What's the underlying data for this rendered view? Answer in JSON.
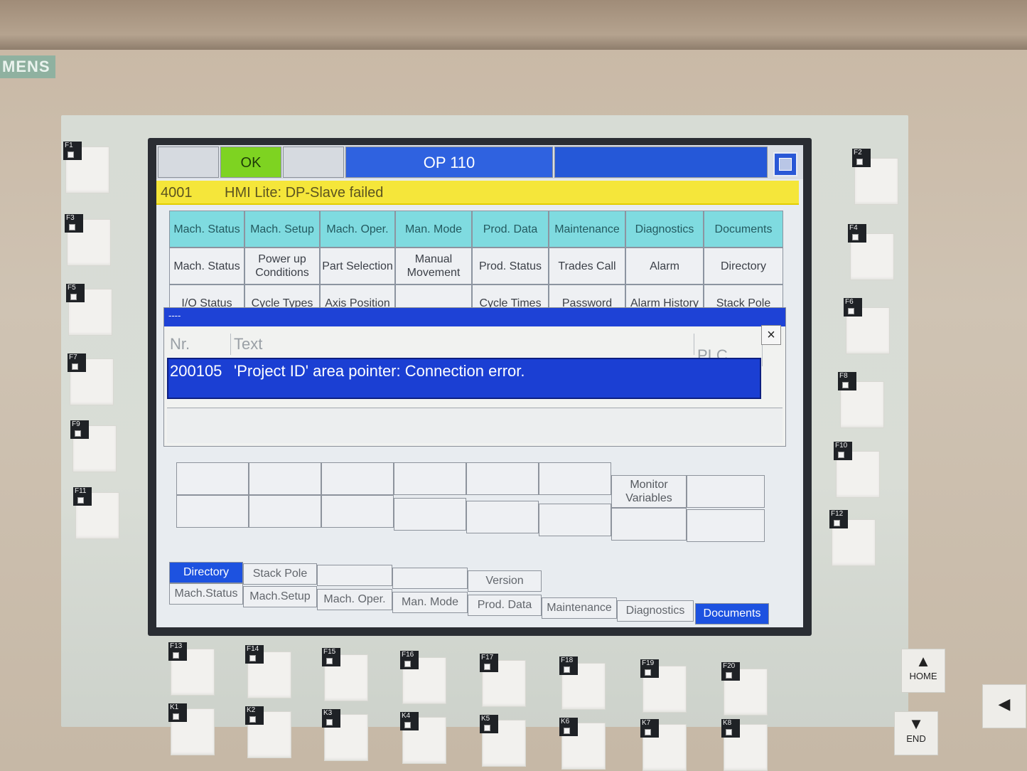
{
  "brand": "MENS",
  "header": {
    "ok_label": "OK",
    "title": "OP 110"
  },
  "alarm_line": {
    "number": "4001",
    "message": "HMI Lite: DP-Slave failed"
  },
  "menu": {
    "row1": [
      "Mach. Status",
      "Mach. Setup",
      "Mach. Oper.",
      "Man. Mode",
      "Prod. Data",
      "Maintenance",
      "Diagnostics",
      "Documents"
    ],
    "row2": [
      "Mach. Status",
      "Power up Conditions",
      "Part Selection",
      "Manual Movement",
      "Prod. Status",
      "Trades Call",
      "Alarm",
      "Directory"
    ],
    "row3": [
      "I/O Status",
      "Cycle Types",
      "Axis Position",
      "",
      "Cycle Times",
      "Password",
      "Alarm History",
      "Stack Pole"
    ]
  },
  "dialog": {
    "title": "----",
    "close": "×",
    "columns": {
      "nr": "Nr.",
      "text": "Text",
      "plc": "PLC"
    },
    "row": {
      "nr": "200105",
      "text": "'Project ID' area pointer: Connection error."
    }
  },
  "lower_grid": {
    "monitor_variables": "Monitor Variables"
  },
  "tabs": {
    "upper": {
      "directory": "Directory",
      "stack_pole": "Stack Pole",
      "version": "Version"
    },
    "lower": [
      "Mach.Status",
      "Mach.Setup",
      "Mach. Oper.",
      "Man. Mode",
      "Prod. Data",
      "Maintenance",
      "Diagnostics",
      "Documents"
    ]
  },
  "keys": {
    "left": [
      "F1",
      "F3",
      "F5",
      "F7",
      "F9",
      "F11"
    ],
    "right": [
      "F2",
      "F4",
      "F6",
      "F8",
      "F10",
      "F12"
    ],
    "bottom_f": [
      "F13",
      "F14",
      "F15",
      "F16",
      "F17",
      "F18",
      "F19",
      "F20"
    ],
    "bottom_k": [
      "K1",
      "K2",
      "K3",
      "K4",
      "K5",
      "K6",
      "K7",
      "K8"
    ],
    "home": "HOME",
    "end": "END"
  },
  "colors": {
    "ok": "#7ed321",
    "title_bar": "#2f62e0",
    "alarm": "#f5e63a",
    "menu_cyan": "#7fdbe0",
    "selection": "#1b3fd3"
  }
}
